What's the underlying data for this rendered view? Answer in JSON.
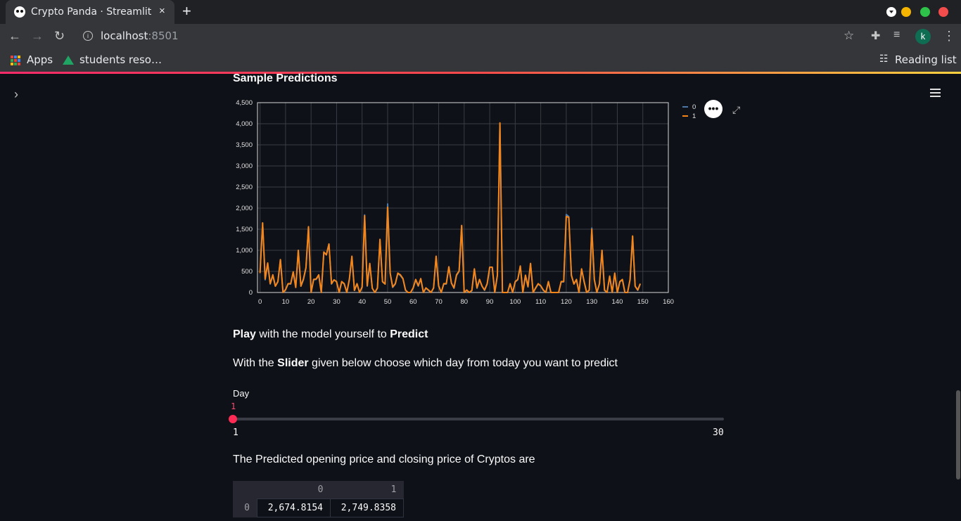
{
  "browser": {
    "tab_title": "Crypto Panda · Streamlit",
    "tab_close": "×",
    "new_tab": "+",
    "url_host": "localhost",
    "url_port": ":8501",
    "avatar_letter": "k",
    "bookmarks": {
      "apps": "Apps",
      "students": "students reso…",
      "reading_list": "Reading list"
    }
  },
  "page": {
    "section_title": "Sample Predictions",
    "play_bold_1": "Play",
    "play_text": " with the model yourself to ",
    "play_bold_2": "Predict",
    "slider_intro_1": "With the ",
    "slider_intro_bold": "Slider",
    "slider_intro_2": " given below choose which day from today you want to predict",
    "slider": {
      "label": "Day",
      "value": "1",
      "min": "1",
      "max": "30",
      "fraction": 0.0
    },
    "predicted_text": "The Predicted opening price and closing price of Cryptos are",
    "table": {
      "columns": [
        "0",
        "1"
      ],
      "rows": [
        {
          "index": "0",
          "values": [
            "2,674.8154",
            "2,749.8358"
          ]
        }
      ]
    }
  },
  "chart_data": {
    "type": "line",
    "x_ticks": [
      0,
      10,
      20,
      30,
      40,
      50,
      60,
      70,
      80,
      90,
      100,
      110,
      120,
      130,
      140,
      150,
      160
    ],
    "y_ticks": [
      0,
      500,
      1000,
      1500,
      2000,
      2500,
      3000,
      3500,
      4000,
      4500
    ],
    "xlim": [
      -1,
      160
    ],
    "ylim": [
      0,
      4500
    ],
    "grid": true,
    "legend_position": "top-right",
    "series": [
      {
        "name": "0",
        "color": "#4c78a8",
        "values": [
          480,
          1650,
          300,
          680,
          200,
          400,
          150,
          250,
          780,
          0,
          60,
          200,
          200,
          480,
          120,
          1000,
          150,
          300,
          580,
          1550,
          0,
          300,
          310,
          400,
          0,
          950,
          900,
          1150,
          200,
          300,
          250,
          0,
          250,
          200,
          0,
          300,
          850,
          50,
          200,
          0,
          120,
          1840,
          150,
          680,
          100,
          0,
          100,
          1250,
          250,
          200,
          2100,
          450,
          120,
          200,
          450,
          400,
          320,
          50,
          0,
          0,
          100,
          300,
          150,
          320,
          0,
          100,
          50,
          0,
          100,
          850,
          150,
          0,
          200,
          200,
          600,
          220,
          100,
          400,
          500,
          1580,
          0,
          50,
          0,
          40,
          550,
          100,
          300,
          150,
          50,
          200,
          600,
          600,
          0,
          400,
          4000,
          0,
          0,
          0,
          200,
          0,
          250,
          300,
          620,
          0,
          400,
          130,
          680,
          0,
          100,
          200,
          150,
          50,
          0,
          250,
          0,
          0,
          0,
          0,
          250,
          250,
          1850,
          1800,
          400,
          200,
          300,
          0,
          550,
          250,
          0,
          50,
          1530,
          300,
          0,
          200,
          1000,
          50,
          0,
          380,
          0,
          450,
          0,
          250,
          300,
          0,
          0,
          300,
          1330,
          150,
          50,
          200
        ]
      },
      {
        "name": "1",
        "color": "#f58518",
        "values": [
          460,
          1650,
          320,
          700,
          210,
          420,
          150,
          260,
          780,
          0,
          70,
          210,
          210,
          490,
          120,
          1000,
          150,
          320,
          590,
          1560,
          0,
          310,
          320,
          420,
          0,
          960,
          890,
          1150,
          210,
          300,
          260,
          0,
          260,
          210,
          0,
          320,
          860,
          50,
          210,
          0,
          130,
          1820,
          160,
          690,
          100,
          0,
          110,
          1260,
          260,
          200,
          2020,
          460,
          130,
          210,
          460,
          420,
          330,
          60,
          0,
          0,
          110,
          310,
          160,
          330,
          0,
          110,
          60,
          0,
          110,
          860,
          160,
          0,
          210,
          210,
          610,
          220,
          110,
          420,
          510,
          1590,
          0,
          60,
          0,
          50,
          560,
          110,
          310,
          150,
          60,
          210,
          600,
          600,
          0,
          410,
          4020,
          0,
          0,
          0,
          210,
          0,
          260,
          310,
          630,
          0,
          410,
          140,
          690,
          0,
          110,
          210,
          160,
          60,
          0,
          260,
          0,
          0,
          0,
          0,
          260,
          260,
          1800,
          1780,
          410,
          200,
          310,
          0,
          560,
          260,
          0,
          60,
          1500,
          310,
          0,
          210,
          1000,
          60,
          0,
          390,
          0,
          460,
          0,
          260,
          310,
          0,
          0,
          310,
          1340,
          150,
          60,
          210
        ]
      }
    ]
  },
  "icons": {
    "sidebar_toggle": "chevron-right-icon",
    "menu": "hamburger-icon",
    "modebar": "more-options-icon",
    "fullscreen": "expand-icon"
  }
}
